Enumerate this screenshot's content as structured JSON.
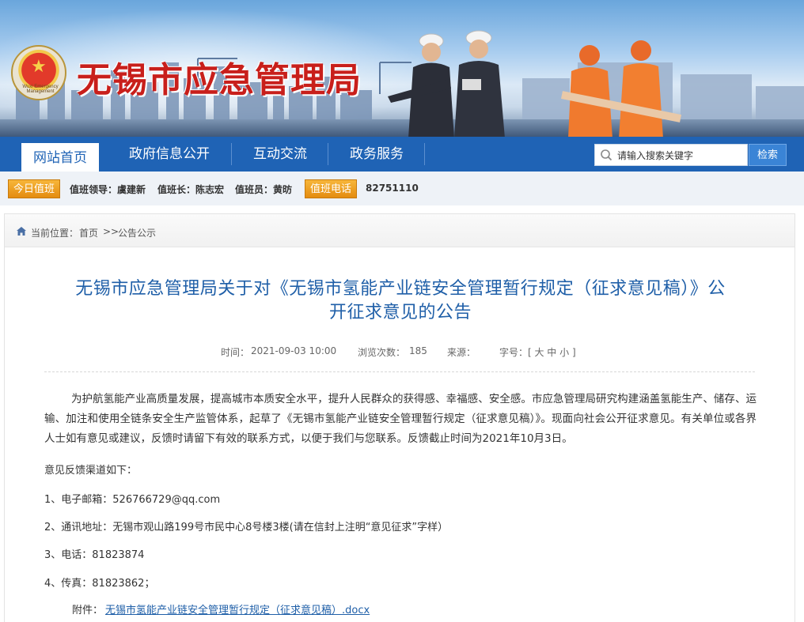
{
  "site": {
    "title": "无锡市应急管理局",
    "emblem_caption": "Wuxi Emergency Management"
  },
  "nav": {
    "items": [
      {
        "label": "网站首页",
        "active": true
      },
      {
        "label": "政府信息公开",
        "active": false
      },
      {
        "label": "互动交流",
        "active": false
      },
      {
        "label": "政务服务",
        "active": false
      }
    ],
    "search": {
      "placeholder": "请输入搜索关键字",
      "button_label": "检索"
    }
  },
  "duty": {
    "today_label": "今日值班",
    "leader": "值班领导：虞建新",
    "chief": "值班长：陈志宏",
    "staff": "值班员：黄昉",
    "phone_label": "值班电话",
    "phone": "82751110"
  },
  "breadcrumb": {
    "prefix": "当前位置：",
    "home": "首页",
    "separator": ">>",
    "current": "公告公示"
  },
  "article": {
    "title_line1": "无锡市应急管理局关于对《无锡市氢能产业链安全管理暂行规定（征求意见稿）》公",
    "title_line2": "开征求意见的公告",
    "meta": {
      "time_label": "时间：",
      "time": "2021-09-03 10:00",
      "views_label": "浏览次数：",
      "views": "185",
      "source_label": "来源：",
      "font_label": "字号：",
      "font_sizes": "[ 大 中 小 ]"
    },
    "intro": "为护航氢能产业高质量发展，提高城市本质安全水平，提升人民群众的获得感、幸福感、安全感。市应急管理局研究构建涵盖氢能生产、储存、运输、加注和使用全链条安全生产监管体系，起草了《无锡市氢能产业链安全管理暂行规定（征求意见稿）》。现面向社会公开征求意见。有关单位或各界人士如有意见或建议，反馈时请留下有效的联系方式，以便于我们与您联系。反馈截止时间为2021年10月3日。",
    "channels_heading": "意见反馈渠道如下：",
    "channels": [
      "1、电子邮箱：526766729@qq.com",
      "2、通讯地址：无锡市观山路199号市民中心8号楼3楼(请在信封上注明“意见征求”字样）",
      "3、电话：81823874",
      "4、传真：81823862；"
    ],
    "attachment_label": "附件：",
    "attachment_name": "无锡市氢能产业链安全管理暂行规定（征求意见稿）.docx"
  },
  "colors": {
    "nav_blue": "#1f63b5",
    "title_red": "#c81f1b",
    "article_title_blue": "#1f5fa8",
    "badge_orange": "#e48c10"
  }
}
